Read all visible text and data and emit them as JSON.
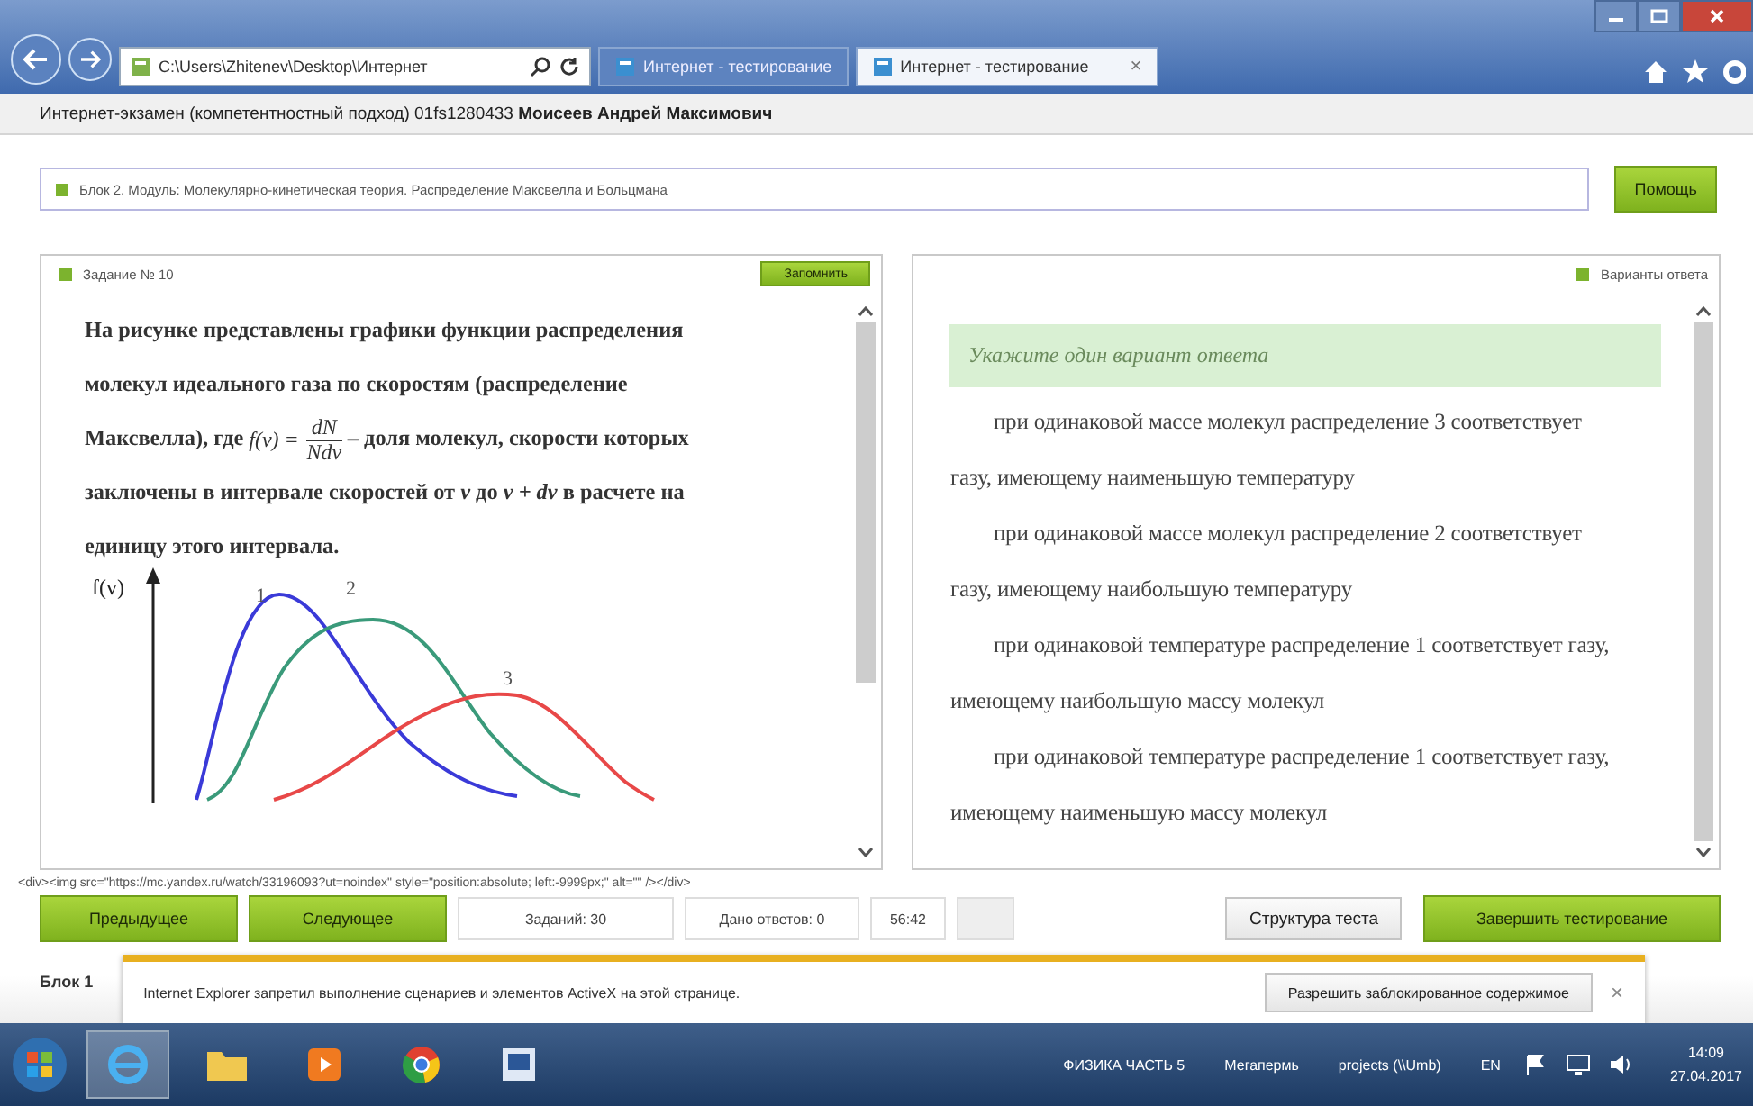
{
  "browser": {
    "address": "C:\\Users\\Zhitenev\\Desktop\\Интернет",
    "tabs": [
      {
        "label": "Интернет - тестирование",
        "selected": false
      },
      {
        "label": "Интернет - тестирование",
        "selected": true
      }
    ],
    "close_glyph": "×"
  },
  "header": "Интернет-экзамен (компетентностный подход) 01fs1280433 **Моисеев Андрей Максимович**",
  "block_bar": {
    "text": "Блок 2. Модуль: Молекулярно-кинетическая теория. Распределение Максвелла и Больцмана",
    "help_button": "Помощь"
  },
  "task": {
    "title": "Задание № 10",
    "button": "Запомнить",
    "text_before": "На рисунке представлены графики функции распределения молекул идеального газа по скоростям (распределение Максвелла), где",
    "formula": {
      "lhs": "f(v) =",
      "numerator": "dN",
      "denominator": "Ndv"
    },
    "text_after": "– доля молекул, скорости которых заключены в интервале скоростей от *v* до *v + dv* в расчете на единицу этого интервала.",
    "graph": {
      "axis_label": "f(v)",
      "curves": [
        {
          "label": "1",
          "color": "#3a3ad8"
        },
        {
          "label": "2",
          "color": "#3a9a7a"
        },
        {
          "label": "3",
          "color": "#e84848"
        }
      ]
    }
  },
  "answers": {
    "title": "Варианты ответа",
    "hint": "Укажите один вариант ответа",
    "options": [
      {
        "text": "при одинаковой массе молекул распределение 3 соответствует газу, имеющему наименьшую температуру",
        "selected": false
      },
      {
        "text": "при одинаковой массе молекул распределение 2 соответствует газу, имеющему наибольшую температуру",
        "selected": false
      },
      {
        "text": "при одинаковой температуре распределение 1 соответствует газу, имеющему наибольшую массу молекул",
        "selected": false
      },
      {
        "text": "при одинаковой температуре распределение 1 соответствует газу, имеющему наименьшую массу молекул",
        "selected": false
      }
    ]
  },
  "source_line": "<div><img src=\"https://mc.yandex.ru/watch/33196093?ut=noindex\" style=\"position:absolute; left:-9999px;\" alt=\"\" /></div>",
  "footer": {
    "previous": "Предыдущее",
    "next": "Следующее",
    "tasks": "Заданий: 30",
    "answered": "Дано ответов: 0",
    "timer": "56:42",
    "structure": "Структура теста",
    "finish": "Завершить тестирование"
  },
  "block_tab": "Блок 1",
  "notification": {
    "text": "Internet Explorer запретил выполнение сценариев и элементов ActiveX на этой странице.",
    "button": "Разрешить заблокированное содержимое",
    "close": "×"
  },
  "taskbar": {
    "items": [
      "ФИЗИКА ЧАСТЬ 5",
      "Мегапермь",
      "projects (\\\\Umb)"
    ],
    "language": "EN",
    "time": "14:09",
    "date": "27.04.2017"
  }
}
